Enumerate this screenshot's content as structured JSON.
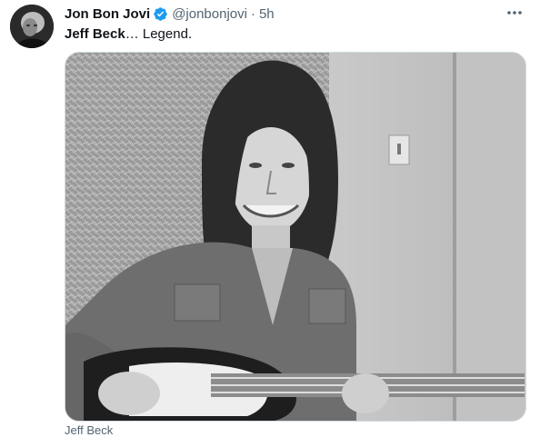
{
  "user": {
    "name": "Jon Bon Jovi",
    "handle": "@jonbonjovi",
    "separator": "·",
    "time": "5h"
  },
  "tweet": {
    "text_bold": "Jeff Beck",
    "text_rest": "… Legend."
  },
  "media": {
    "caption": "Jeff Beck"
  },
  "colors": {
    "verified": "#1d9bf0",
    "secondary_text": "#536471",
    "border": "#cfd9de"
  },
  "icons": {
    "verified": "verified-badge-icon",
    "more": "more-options-icon"
  }
}
